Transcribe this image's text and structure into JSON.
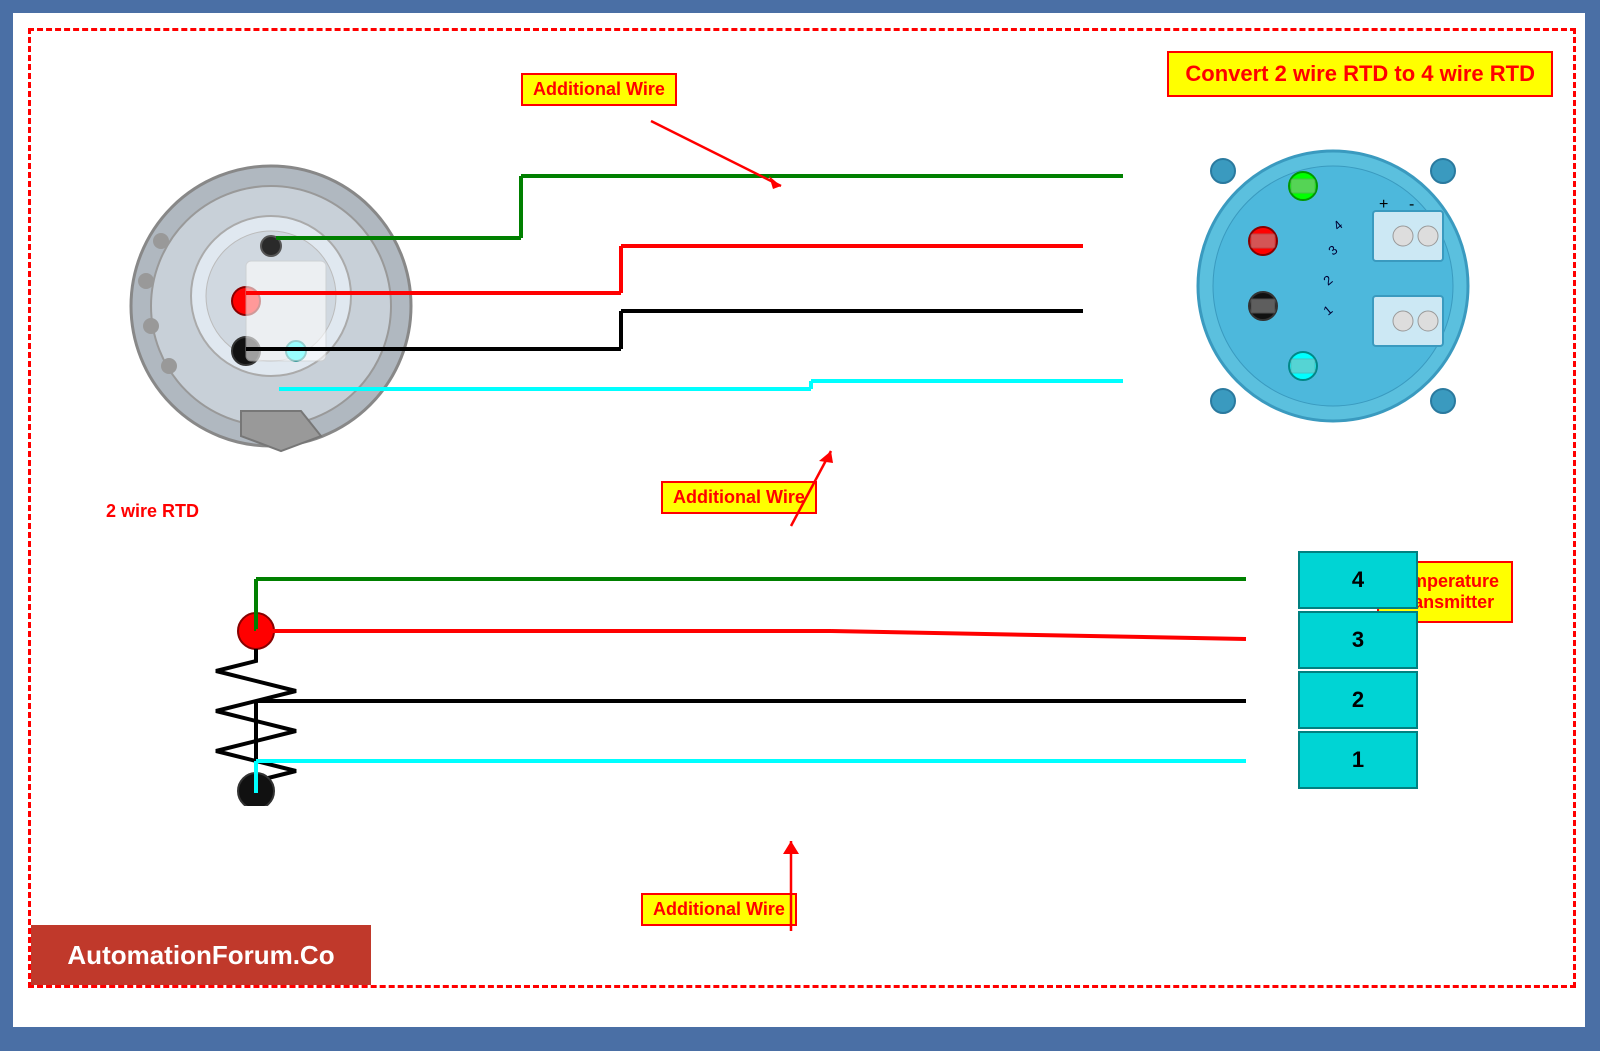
{
  "title": "Convert 2 wire RTD to 4 wire RTD",
  "labels": {
    "additional_wire_1": "Additional Wire",
    "additional_wire_2": "Additional Wire",
    "additional_wire_3": "Additional Wire",
    "two_wire_rtd": "2 wire RTD",
    "temp_transmitter_line1": "Temperature",
    "temp_transmitter_line2": "Transmitter"
  },
  "terminal": {
    "cells": [
      "4",
      "3",
      "2",
      "1"
    ]
  },
  "footer": {
    "text": "AutomationForum.Co"
  }
}
